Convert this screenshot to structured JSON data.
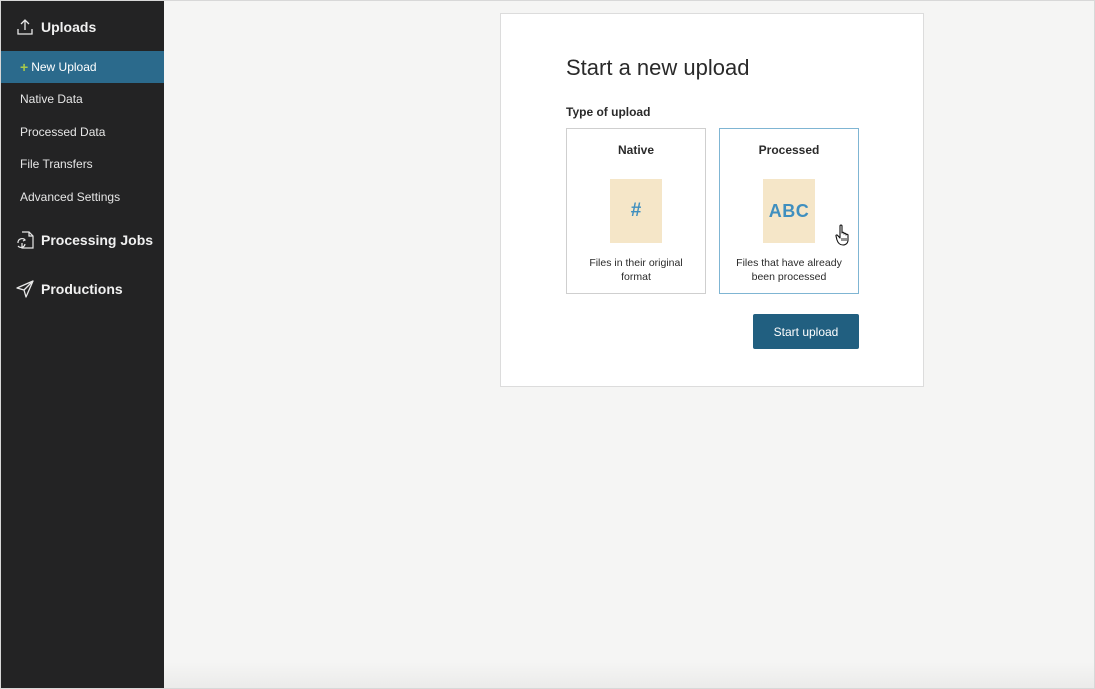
{
  "sidebar": {
    "uploads_title": "Uploads",
    "items": [
      {
        "label": "New Upload",
        "active": true,
        "prefix": "+"
      },
      {
        "label": "Native Data"
      },
      {
        "label": "Processed Data"
      },
      {
        "label": "File Transfers"
      },
      {
        "label": "Advanced Settings"
      }
    ],
    "processing_jobs_title": "Processing Jobs",
    "productions_title": "Productions"
  },
  "main": {
    "title": "Start a new upload",
    "type_label": "Type of upload",
    "options": [
      {
        "title": "Native",
        "thumb_text": "#",
        "description": "Files in their original format",
        "icon": "hash-file-icon"
      },
      {
        "title": "Processed",
        "thumb_text": "ABC",
        "description": "Files that have already been processed",
        "icon": "abc-file-icon",
        "hovered": true
      }
    ],
    "start_button": "Start upload"
  },
  "colors": {
    "sidebar_bg": "#232324",
    "active_item": "#2b6a8c",
    "plus_accent": "#a8c94a",
    "button": "#215f80",
    "thumb_bg": "#f5e6c8",
    "thumb_text": "#3f8fbf",
    "hover_border": "#7fb5d3"
  }
}
